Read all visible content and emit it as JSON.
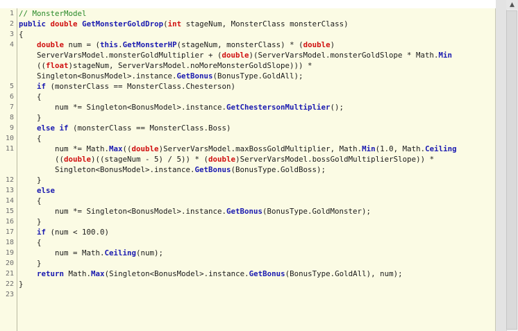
{
  "lines": [
    {
      "n": "1",
      "tokens": [
        {
          "c": "cm",
          "t": "// MonsterModel"
        }
      ]
    },
    {
      "n": "2",
      "tokens": [
        {
          "c": "kw",
          "t": "public"
        },
        {
          "c": "",
          "t": " "
        },
        {
          "c": "ty",
          "t": "double"
        },
        {
          "c": "",
          "t": " "
        },
        {
          "c": "fn",
          "t": "GetMonsterGoldDrop"
        },
        {
          "c": "",
          "t": "("
        },
        {
          "c": "ty",
          "t": "int"
        },
        {
          "c": "",
          "t": " stageNum, MonsterClass monsterClass)"
        }
      ]
    },
    {
      "n": "3",
      "tokens": [
        {
          "c": "",
          "t": "{"
        }
      ]
    },
    {
      "n": "4",
      "tokens": [
        {
          "c": "",
          "t": "    "
        },
        {
          "c": "ty",
          "t": "double"
        },
        {
          "c": "",
          "t": " num = ("
        },
        {
          "c": "kw",
          "t": "this"
        },
        {
          "c": "",
          "t": "."
        },
        {
          "c": "fn",
          "t": "GetMonsterHP"
        },
        {
          "c": "",
          "t": "(stageNum, monsterClass) * ("
        },
        {
          "c": "ty",
          "t": "double"
        },
        {
          "c": "",
          "t": ")"
        }
      ]
    },
    {
      "n": "",
      "tokens": [
        {
          "c": "",
          "t": "    ServerVarsModel.monsterGoldMultiplier + ("
        },
        {
          "c": "ty",
          "t": "double"
        },
        {
          "c": "",
          "t": ")(ServerVarsModel.monsterGoldSlope * Math."
        },
        {
          "c": "fn",
          "t": "Min"
        }
      ]
    },
    {
      "n": "",
      "tokens": [
        {
          "c": "",
          "t": "    (("
        },
        {
          "c": "ty",
          "t": "float"
        },
        {
          "c": "",
          "t": ")stageNum, ServerVarsModel.noMoreMonsterGoldSlope))) *"
        }
      ]
    },
    {
      "n": "",
      "tokens": [
        {
          "c": "",
          "t": "    Singleton<BonusModel>.instance."
        },
        {
          "c": "fn",
          "t": "GetBonus"
        },
        {
          "c": "",
          "t": "(BonusType.GoldAll);"
        }
      ]
    },
    {
      "n": "5",
      "tokens": [
        {
          "c": "",
          "t": "    "
        },
        {
          "c": "kw",
          "t": "if"
        },
        {
          "c": "",
          "t": " (monsterClass == MonsterClass.Chesterson)"
        }
      ]
    },
    {
      "n": "6",
      "tokens": [
        {
          "c": "",
          "t": "    {"
        }
      ]
    },
    {
      "n": "7",
      "tokens": [
        {
          "c": "",
          "t": "        num *= Singleton<BonusModel>.instance."
        },
        {
          "c": "fn",
          "t": "GetChestersonMultiplier"
        },
        {
          "c": "",
          "t": "();"
        }
      ]
    },
    {
      "n": "8",
      "tokens": [
        {
          "c": "",
          "t": "    }"
        }
      ]
    },
    {
      "n": "9",
      "tokens": [
        {
          "c": "",
          "t": "    "
        },
        {
          "c": "kw",
          "t": "else if"
        },
        {
          "c": "",
          "t": " (monsterClass == MonsterClass.Boss)"
        }
      ]
    },
    {
      "n": "10",
      "tokens": [
        {
          "c": "",
          "t": "    {"
        }
      ]
    },
    {
      "n": "11",
      "tokens": [
        {
          "c": "",
          "t": "        num *= Math."
        },
        {
          "c": "fn",
          "t": "Max"
        },
        {
          "c": "",
          "t": "(("
        },
        {
          "c": "ty",
          "t": "double"
        },
        {
          "c": "",
          "t": ")ServerVarsModel.maxBossGoldMultiplier, Math."
        },
        {
          "c": "fn",
          "t": "Min"
        },
        {
          "c": "",
          "t": "(1.0, Math."
        },
        {
          "c": "fn",
          "t": "Ceiling"
        }
      ]
    },
    {
      "n": "",
      "tokens": [
        {
          "c": "",
          "t": "        (("
        },
        {
          "c": "ty",
          "t": "double"
        },
        {
          "c": "",
          "t": ")((stageNum - 5) / 5)) * ("
        },
        {
          "c": "ty",
          "t": "double"
        },
        {
          "c": "",
          "t": ")ServerVarsModel.bossGoldMultiplierSlope)) *"
        }
      ]
    },
    {
      "n": "",
      "tokens": [
        {
          "c": "",
          "t": "        Singleton<BonusModel>.instance."
        },
        {
          "c": "fn",
          "t": "GetBonus"
        },
        {
          "c": "",
          "t": "(BonusType.GoldBoss);"
        }
      ]
    },
    {
      "n": "12",
      "tokens": [
        {
          "c": "",
          "t": "    }"
        }
      ]
    },
    {
      "n": "13",
      "tokens": [
        {
          "c": "",
          "t": "    "
        },
        {
          "c": "kw",
          "t": "else"
        }
      ]
    },
    {
      "n": "14",
      "tokens": [
        {
          "c": "",
          "t": "    {"
        }
      ]
    },
    {
      "n": "15",
      "tokens": [
        {
          "c": "",
          "t": "        num *= Singleton<BonusModel>.instance."
        },
        {
          "c": "fn",
          "t": "GetBonus"
        },
        {
          "c": "",
          "t": "(BonusType.GoldMonster);"
        }
      ]
    },
    {
      "n": "16",
      "tokens": [
        {
          "c": "",
          "t": "    }"
        }
      ]
    },
    {
      "n": "17",
      "tokens": [
        {
          "c": "",
          "t": "    "
        },
        {
          "c": "kw",
          "t": "if"
        },
        {
          "c": "",
          "t": " (num < 100.0)"
        }
      ]
    },
    {
      "n": "18",
      "tokens": [
        {
          "c": "",
          "t": "    {"
        }
      ]
    },
    {
      "n": "19",
      "tokens": [
        {
          "c": "",
          "t": "        num = Math."
        },
        {
          "c": "fn",
          "t": "Ceiling"
        },
        {
          "c": "",
          "t": "(num);"
        }
      ]
    },
    {
      "n": "20",
      "tokens": [
        {
          "c": "",
          "t": "    }"
        }
      ]
    },
    {
      "n": "21",
      "tokens": [
        {
          "c": "",
          "t": "    "
        },
        {
          "c": "kw",
          "t": "return"
        },
        {
          "c": "",
          "t": " Math."
        },
        {
          "c": "fn",
          "t": "Max"
        },
        {
          "c": "",
          "t": "(Singleton<BonusModel>.instance."
        },
        {
          "c": "fn",
          "t": "GetBonus"
        },
        {
          "c": "",
          "t": "(BonusType.GoldAll), num);"
        }
      ]
    },
    {
      "n": "22",
      "tokens": [
        {
          "c": "",
          "t": "}"
        }
      ]
    },
    {
      "n": "23",
      "tokens": []
    }
  ],
  "scrollbar": {
    "up_arrow": "▲"
  },
  "colors": {
    "background": "#fbfbe4",
    "keyword": "#1a1ab0",
    "type": "#d01010",
    "comment": "#2a8a2a"
  }
}
